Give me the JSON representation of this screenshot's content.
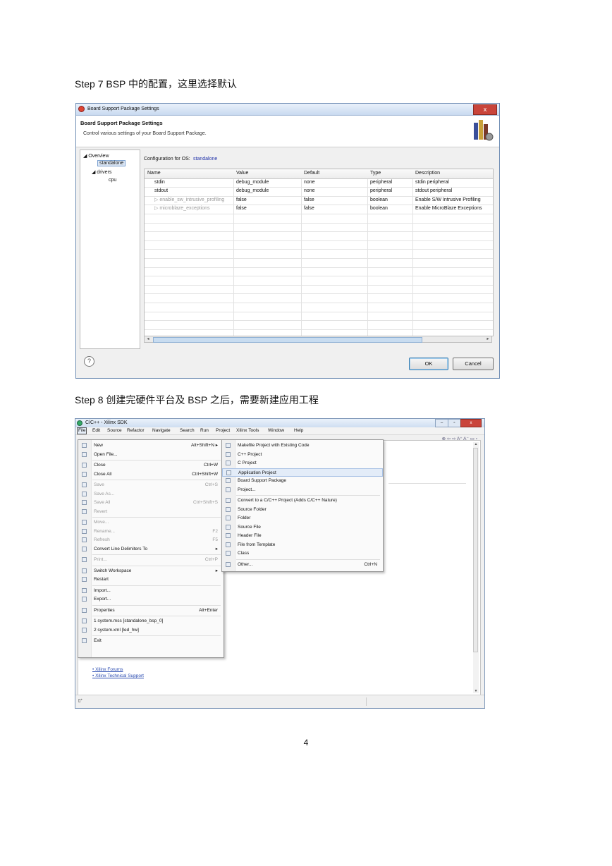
{
  "step7": {
    "title": "Step 7  BSP 中的配置，这里选择默认"
  },
  "step8": {
    "title": "Step 8 创建完硬件平台及 BSP 之后，需要新建应用工程"
  },
  "page_number": "4",
  "bsp_dialog": {
    "window_title": "Board Support Package Settings",
    "close_glyph": "x",
    "header_title": "Board Support Package Settings",
    "header_subtitle": "Control various settings of your Board Support Package.",
    "tree": {
      "overview": "◢ Overview",
      "standalone": "standalone",
      "drivers": "◢ drivers",
      "cpu": "cpu"
    },
    "config_label": "Configuration for OS:",
    "config_os": "standalone",
    "columns": [
      "Name",
      "Value",
      "Default",
      "Type",
      "Description"
    ],
    "rows": [
      [
        "stdin",
        "debug_module",
        "none",
        "peripheral",
        "stdin peripheral"
      ],
      [
        "stdout",
        "debug_module",
        "none",
        "peripheral",
        "stdout peripheral"
      ],
      [
        "▷ enable_sw_intrusive_profiling",
        "false",
        "false",
        "boolean",
        "Enable S/W Intrusive Profiling"
      ],
      [
        "▷ microblaze_exceptions",
        "false",
        "false",
        "boolean",
        "Enable MicroBlaze Exceptions"
      ]
    ],
    "help_glyph": "?",
    "ok_label": "OK",
    "cancel_label": "Cancel"
  },
  "sdk_window": {
    "window_title": "C/C++ - Xilinx SDK",
    "menubar": [
      "File",
      "Edit",
      "Source",
      "Refactor",
      "Navigate",
      "Search",
      "Run",
      "Project",
      "Xilinx Tools",
      "Window",
      "Help"
    ],
    "toolbar_icons": "⊕ ⇦ ⇨ A⁺ A⁻ ▭ ▫",
    "file_menu": [
      {
        "label": "New",
        "accel": "Alt+Shift+N ▸",
        "disabled": false
      },
      {
        "label": "Open File...",
        "accel": "",
        "disabled": false
      },
      {
        "sep": true
      },
      {
        "label": "Close",
        "accel": "Ctrl+W",
        "disabled": false
      },
      {
        "label": "Close All",
        "accel": "Ctrl+Shift+W",
        "disabled": false
      },
      {
        "sep": true
      },
      {
        "label": "Save",
        "accel": "Ctrl+S",
        "disabled": true
      },
      {
        "label": "Save As...",
        "accel": "",
        "disabled": true
      },
      {
        "label": "Save All",
        "accel": "Ctrl+Shift+S",
        "disabled": true
      },
      {
        "label": "Revert",
        "accel": "",
        "disabled": true
      },
      {
        "sep": true
      },
      {
        "label": "Move...",
        "accel": "",
        "disabled": true
      },
      {
        "label": "Rename...",
        "accel": "F2",
        "disabled": true
      },
      {
        "label": "Refresh",
        "accel": "F5",
        "disabled": true
      },
      {
        "label": "Convert Line Delimiters To",
        "accel": "▸",
        "disabled": false
      },
      {
        "sep": true
      },
      {
        "label": "Print...",
        "accel": "Ctrl+P",
        "disabled": true
      },
      {
        "sep": true
      },
      {
        "label": "Switch Workspace",
        "accel": "▸",
        "disabled": false
      },
      {
        "label": "Restart",
        "accel": "",
        "disabled": false
      },
      {
        "sep": true
      },
      {
        "label": "Import...",
        "accel": "",
        "disabled": false
      },
      {
        "label": "Export...",
        "accel": "",
        "disabled": false
      },
      {
        "sep": true
      },
      {
        "label": "Properties",
        "accel": "Alt+Enter",
        "disabled": false
      },
      {
        "sep": true
      },
      {
        "label": "1 system.mss  [standalone_bsp_0]",
        "accel": "",
        "disabled": false
      },
      {
        "label": "2 system.xml  [led_hw]",
        "accel": "",
        "disabled": false
      },
      {
        "sep": true
      },
      {
        "label": "Exit",
        "accel": "",
        "disabled": false
      }
    ],
    "new_submenu": [
      {
        "label": "Makefile Project with Existing Code",
        "accel": ""
      },
      {
        "label": "C++ Project",
        "accel": ""
      },
      {
        "label": "C Project",
        "accel": ""
      },
      {
        "label": "Application Project",
        "accel": "",
        "highlight": true
      },
      {
        "label": "Board Support Package",
        "accel": ""
      },
      {
        "label": "Project...",
        "accel": ""
      },
      {
        "sep": true
      },
      {
        "label": "Convert to a C/C++ Project (Adds C/C++ Nature)",
        "accel": ""
      },
      {
        "label": "Source Folder",
        "accel": ""
      },
      {
        "label": "Folder",
        "accel": ""
      },
      {
        "label": "Source File",
        "accel": ""
      },
      {
        "label": "Header File",
        "accel": ""
      },
      {
        "label": "File from Template",
        "accel": ""
      },
      {
        "label": "Class",
        "accel": ""
      },
      {
        "sep": true
      },
      {
        "label": "Other...",
        "accel": "Ctrl+N"
      }
    ],
    "links": [
      "Xilinx Forums",
      "Xilinx Technical Support"
    ],
    "status_icon": "▯⁺"
  }
}
